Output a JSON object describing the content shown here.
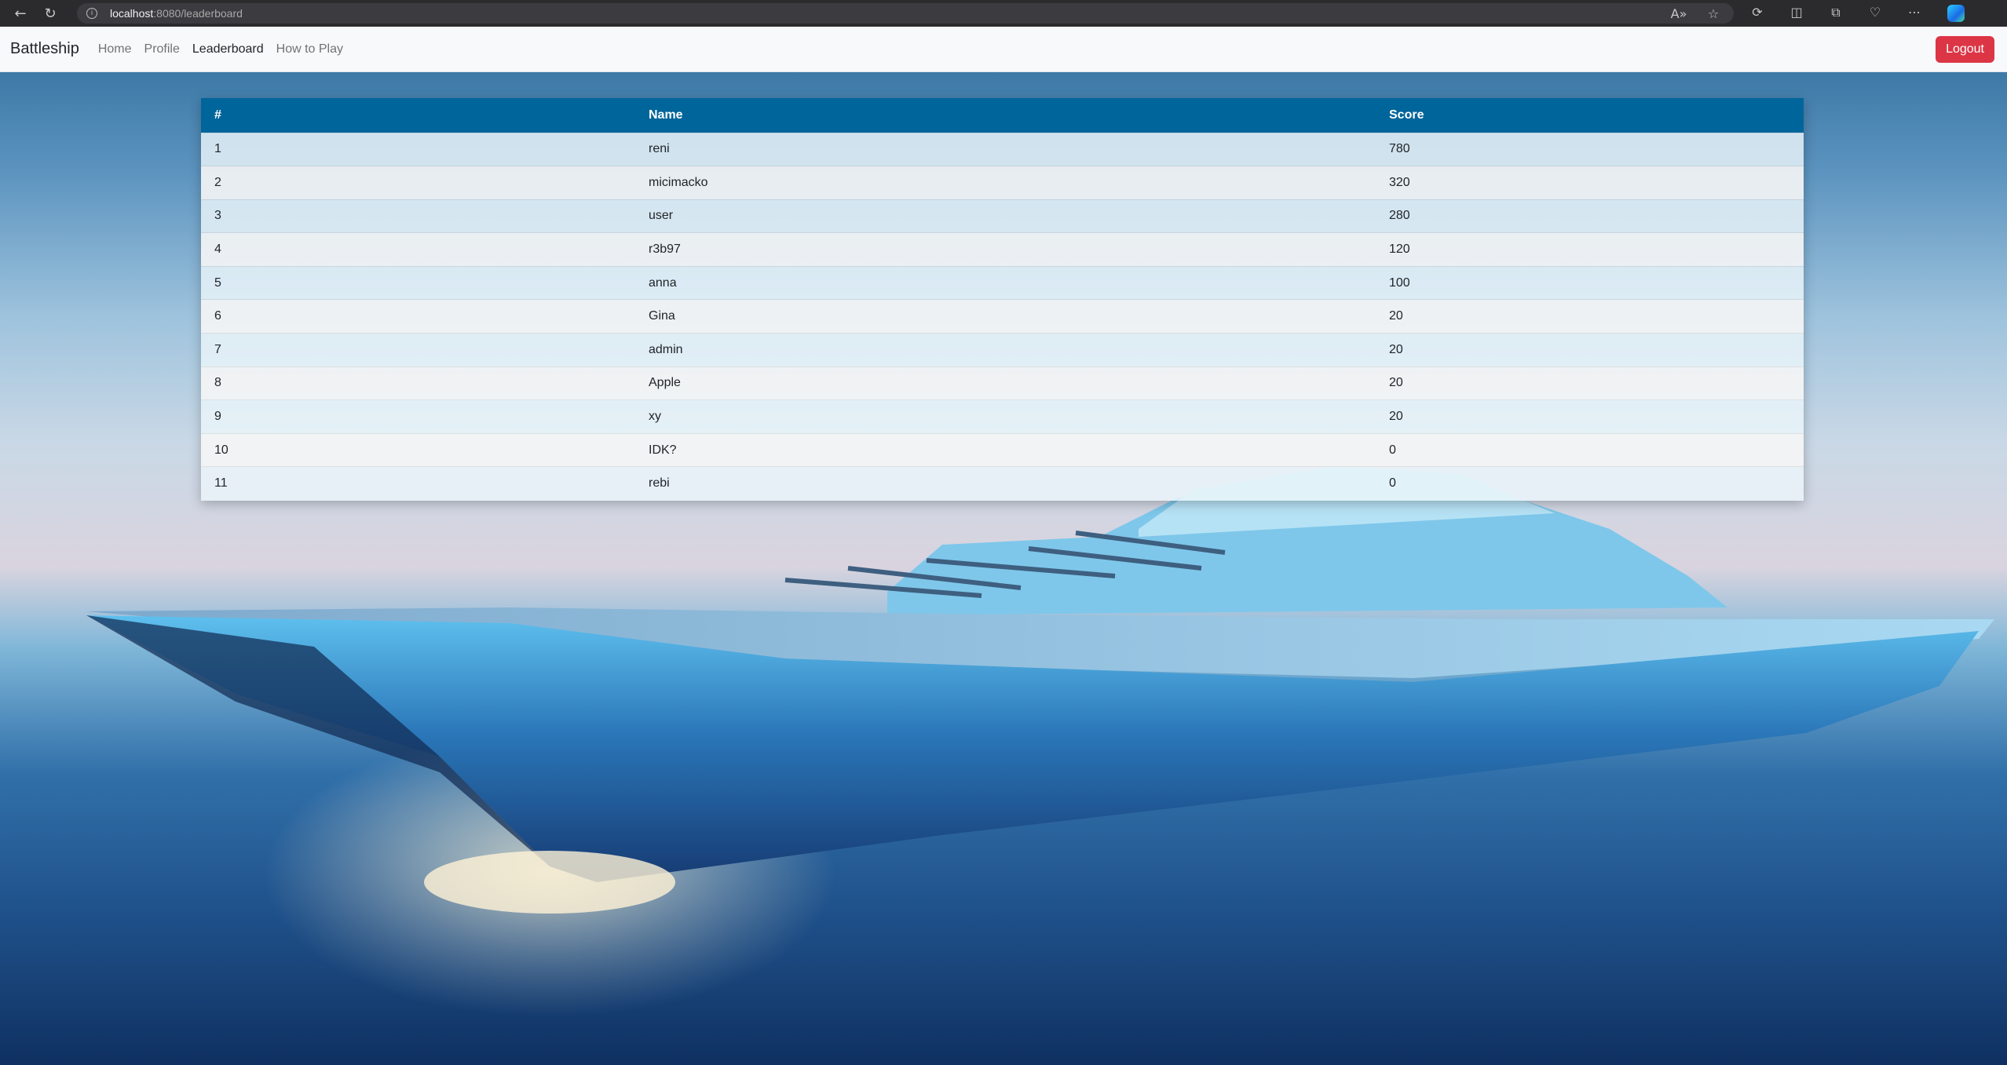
{
  "browser": {
    "url_host": "localhost",
    "url_path": ":8080/leaderboard"
  },
  "navbar": {
    "brand": "Battleship",
    "links": [
      "Home",
      "Profile",
      "Leaderboard",
      "How to Play"
    ],
    "active_link": "Leaderboard",
    "logout_label": "Logout"
  },
  "leaderboard": {
    "headers": [
      "#",
      "Name",
      "Score"
    ],
    "rows": [
      {
        "rank": "1",
        "name": "reni",
        "score": "780"
      },
      {
        "rank": "2",
        "name": "micimacko",
        "score": "320"
      },
      {
        "rank": "3",
        "name": "user",
        "score": "280"
      },
      {
        "rank": "4",
        "name": "r3b97",
        "score": "120"
      },
      {
        "rank": "5",
        "name": "anna",
        "score": "100"
      },
      {
        "rank": "6",
        "name": "Gina",
        "score": "20"
      },
      {
        "rank": "7",
        "name": "admin",
        "score": "20"
      },
      {
        "rank": "8",
        "name": "Apple",
        "score": "20"
      },
      {
        "rank": "9",
        "name": "xy",
        "score": "20"
      },
      {
        "rank": "10",
        "name": "IDK?",
        "score": "0"
      },
      {
        "rank": "11",
        "name": "rebi",
        "score": "0"
      }
    ]
  },
  "colors": {
    "table_header": "#00659a",
    "logout_button": "#dc3545",
    "navbar_bg": "#f8f9fa"
  }
}
